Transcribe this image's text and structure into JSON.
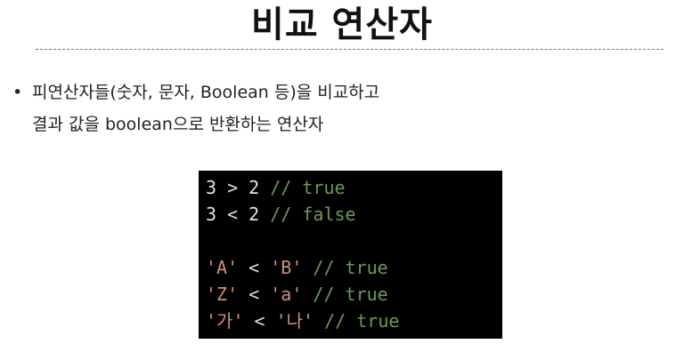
{
  "slide": {
    "title": "비교 연산자",
    "bullet_symbol": "•",
    "bullet_lines": [
      "피연산자들(숫자, 문자, Boolean 등)을 비교하고",
      "결과 값을 boolean으로 반환하는 연산자"
    ]
  },
  "code": {
    "lines": [
      [
        {
          "t": "3",
          "k": "num"
        },
        {
          "t": " > ",
          "k": "op"
        },
        {
          "t": "2",
          "k": "num"
        },
        {
          "t": " // true",
          "k": "comment"
        }
      ],
      [
        {
          "t": "3",
          "k": "num"
        },
        {
          "t": " < ",
          "k": "op"
        },
        {
          "t": "2",
          "k": "num"
        },
        {
          "t": " // false",
          "k": "comment"
        }
      ],
      [],
      [
        {
          "t": "'A'",
          "k": "str"
        },
        {
          "t": " < ",
          "k": "op"
        },
        {
          "t": "'B'",
          "k": "str"
        },
        {
          "t": " // true",
          "k": "comment"
        }
      ],
      [
        {
          "t": "'Z'",
          "k": "str"
        },
        {
          "t": " < ",
          "k": "op"
        },
        {
          "t": "'a'",
          "k": "str"
        },
        {
          "t": " // true",
          "k": "comment"
        }
      ],
      [
        {
          "t": "'가'",
          "k": "str"
        },
        {
          "t": " < ",
          "k": "op"
        },
        {
          "t": "'나'",
          "k": "str"
        },
        {
          "t": " // true",
          "k": "comment"
        }
      ]
    ],
    "colors": {
      "background": "#000000",
      "number": "#dde9d8",
      "operator": "#dddddd",
      "comment": "#6a9955",
      "string": "#ce9178"
    }
  }
}
